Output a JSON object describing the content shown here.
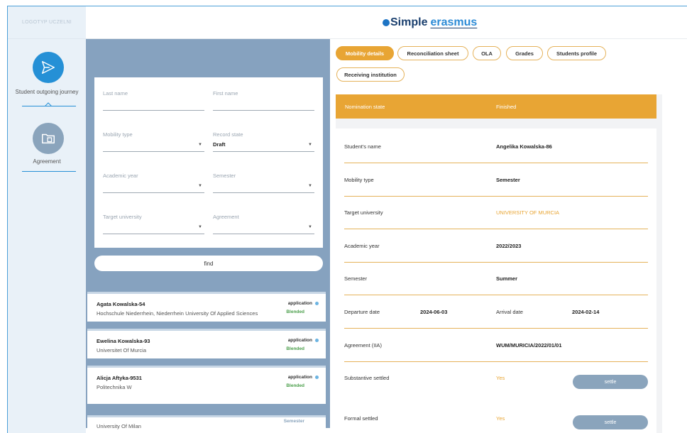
{
  "header": {
    "logo_placeholder": "LOGOTYP UCZELNI",
    "brand_simple": "Simple",
    "brand_erasmus": "erasmus"
  },
  "sidebar": {
    "items": [
      {
        "label": "Student outgoing journey",
        "icon": "airplane-icon",
        "active": true
      },
      {
        "label": "Agreement",
        "icon": "folder-icon",
        "active": false
      }
    ]
  },
  "filters": {
    "last_name_label": "Last name",
    "first_name_label": "First name",
    "mobility_type_label": "Mobility type",
    "record_state_label": "Record state",
    "record_state_value": "Draft",
    "academic_year_label": "Academic year",
    "semester_label": "Semester",
    "target_university_label": "Target university",
    "agreement_label": "Agreement",
    "find_label": "find"
  },
  "results": [
    {
      "name": "Agata Kowalska-54",
      "university": "Hochschule Niederrhein, Niederrhein University Of Applied Sciences",
      "status": "application",
      "type": "Blended"
    },
    {
      "name": "Ewelina Kowalska-93",
      "university": "Universitet Of Murcia",
      "status": "application",
      "type": "Blended"
    },
    {
      "name": "Alicja Aftyka-9531",
      "university": "Politechnika W",
      "status": "application",
      "type": "Blended"
    },
    {
      "name": "",
      "university": "University Of Milan",
      "status": "",
      "type": "Semester"
    }
  ],
  "tabs": [
    {
      "label": "Mobility details",
      "active": true
    },
    {
      "label": "Reconciliation sheet",
      "active": false
    },
    {
      "label": "OLA",
      "active": false
    },
    {
      "label": "Grades",
      "active": false
    },
    {
      "label": "Students profile",
      "active": false
    },
    {
      "label": "Receiving institution",
      "active": false
    }
  ],
  "nomination": {
    "label": "Nomination state",
    "value": "Finished"
  },
  "details": {
    "student_name_label": "Student's name",
    "student_name_value": "Angelika Kowalska-86",
    "mobility_type_label": "Mobility type",
    "mobility_type_value": "Semester",
    "target_university_label": "Target university",
    "target_university_value": "UNIVERSITY OF MURCIA",
    "academic_year_label": "Academic year",
    "academic_year_value": "2022/2023",
    "semester_label": "Semester",
    "semester_value": "Summer",
    "departure_date_label": "Departure date",
    "departure_date_value": "2024-06-03",
    "arrival_date_label": "Arrival date",
    "arrival_date_value": "2024-02-14",
    "agreement_label": "Agreement (IIA)",
    "agreement_value": "WUM/MURICIA/2022/01/01",
    "substantive_settled_label": "Substantive settled",
    "substantive_settled_value": "Yes",
    "formal_settled_label": "Formal settled",
    "formal_settled_value": "Yes",
    "settle_label": "settle"
  },
  "colors": {
    "accent_orange": "#e8a534",
    "primary_blue": "#2590d6",
    "panel_blue": "#86a2bf"
  }
}
